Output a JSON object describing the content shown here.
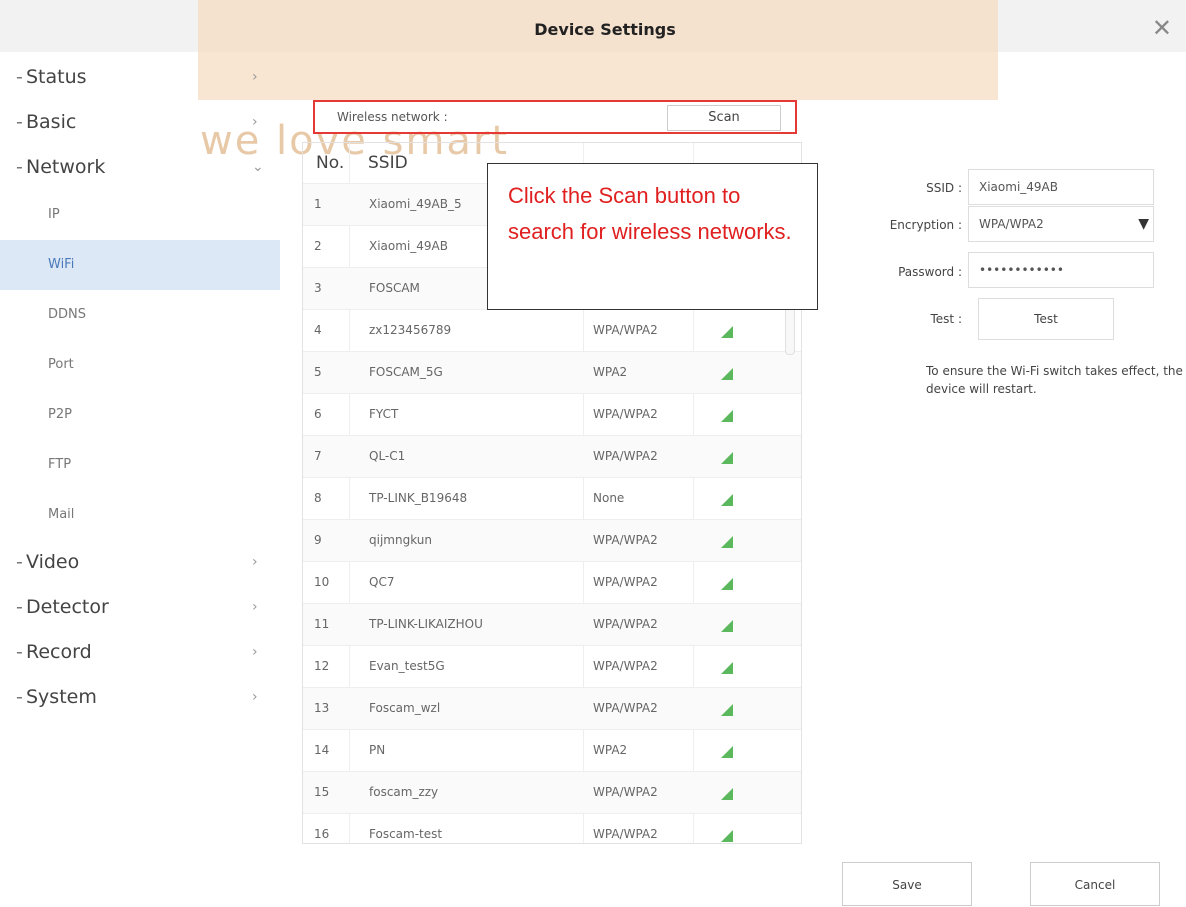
{
  "window": {
    "title": "Device Settings",
    "watermark": "we love smart"
  },
  "sidebar": {
    "items": [
      {
        "label": "Status"
      },
      {
        "label": "Basic"
      },
      {
        "label": "Network"
      }
    ],
    "network_sub": [
      {
        "label": "IP"
      },
      {
        "label": "WiFi"
      },
      {
        "label": "DDNS"
      },
      {
        "label": "Port"
      },
      {
        "label": "P2P"
      },
      {
        "label": "FTP"
      },
      {
        "label": "Mail"
      }
    ],
    "items_after": [
      {
        "label": "Video"
      },
      {
        "label": "Detector"
      },
      {
        "label": "Record"
      },
      {
        "label": "System"
      }
    ]
  },
  "scan": {
    "label": "Wireless network :",
    "button": "Scan"
  },
  "table": {
    "headers": {
      "no": "No.",
      "ssid": "SSID"
    },
    "rows": [
      {
        "no": "1",
        "ssid": "Xiaomi_49AB_5",
        "enc": ""
      },
      {
        "no": "2",
        "ssid": "Xiaomi_49AB",
        "enc": ""
      },
      {
        "no": "3",
        "ssid": "FOSCAM",
        "enc": ""
      },
      {
        "no": "4",
        "ssid": "zx123456789",
        "enc": "WPA/WPA2"
      },
      {
        "no": "5",
        "ssid": "FOSCAM_5G",
        "enc": "WPA2"
      },
      {
        "no": "6",
        "ssid": "FYCT",
        "enc": "WPA/WPA2"
      },
      {
        "no": "7",
        "ssid": "QL-C1",
        "enc": "WPA/WPA2"
      },
      {
        "no": "8",
        "ssid": "TP-LINK_B19648",
        "enc": "None"
      },
      {
        "no": "9",
        "ssid": "qijmngkun",
        "enc": "WPA/WPA2"
      },
      {
        "no": "10",
        "ssid": "QC7",
        "enc": "WPA/WPA2"
      },
      {
        "no": "11",
        "ssid": "TP-LINK-LIKAIZHOU",
        "enc": "WPA/WPA2"
      },
      {
        "no": "12",
        "ssid": "Evan_test5G",
        "enc": "WPA/WPA2"
      },
      {
        "no": "13",
        "ssid": "Foscam_wzl",
        "enc": "WPA/WPA2"
      },
      {
        "no": "14",
        "ssid": "PN",
        "enc": "WPA2"
      },
      {
        "no": "15",
        "ssid": "foscam_zzy",
        "enc": "WPA/WPA2"
      },
      {
        "no": "16",
        "ssid": "Foscam-test",
        "enc": "WPA/WPA2"
      }
    ]
  },
  "callout": {
    "text": "Click the Scan button to search for wireless networks."
  },
  "form": {
    "ssid_label": "SSID :",
    "ssid_value": "Xiaomi_49AB",
    "encryption_label": "Encryption :",
    "encryption_value": "WPA/WPA2",
    "password_label": "Password :",
    "password_value": "••••••••••••",
    "test_label": "Test :",
    "test_button": "Test",
    "note": "To ensure the Wi-Fi switch takes effect, the device will restart."
  },
  "buttons": {
    "save": "Save",
    "cancel": "Cancel"
  },
  "colors": {
    "accent_red": "#e53935",
    "active_bg": "#dde8f6",
    "signal_green": "#5cb85c",
    "watermark": "#f6dcbf"
  }
}
